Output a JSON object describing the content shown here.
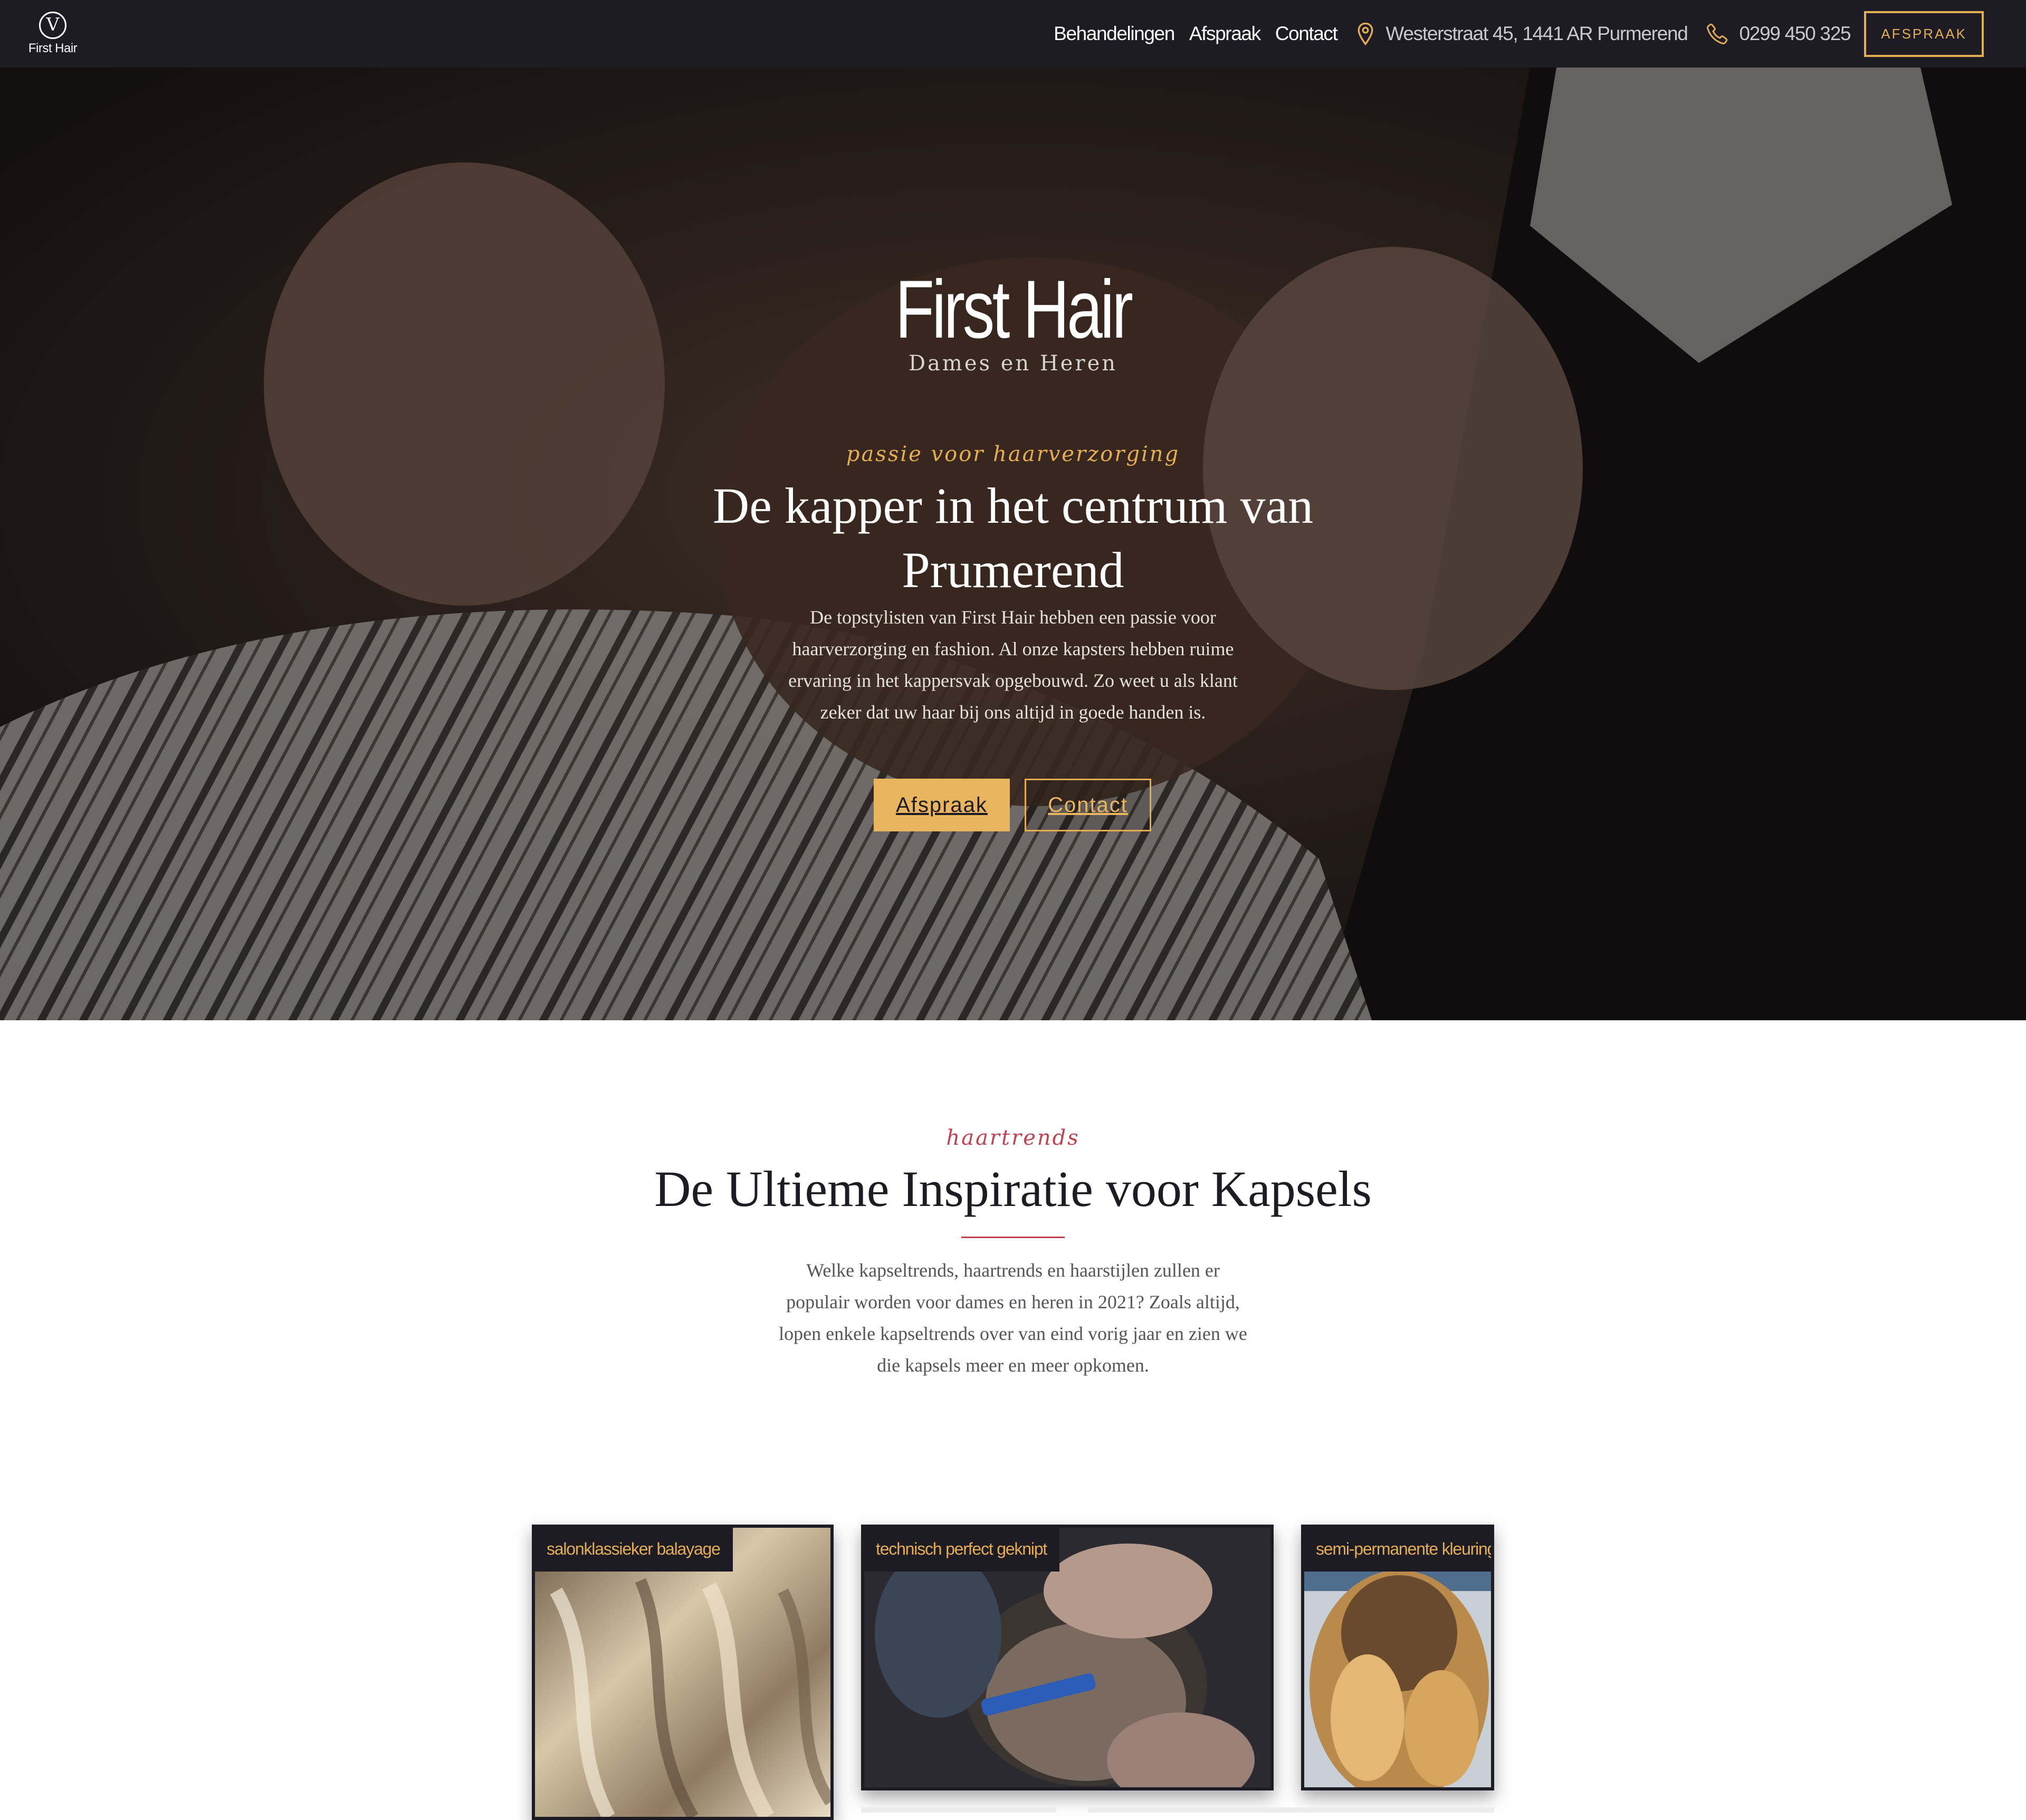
{
  "header": {
    "logo_mark": "V",
    "logo_text": "First Hair",
    "nav": [
      "Behandelingen",
      "Afspraak",
      "Contact"
    ],
    "address": "Westerstraat 45, 1441 AR Purmerend",
    "phone": "0299 450 325",
    "cta": "AFSPRAAK"
  },
  "hero": {
    "brand": "First Hair",
    "brand_sub": "Dames en Heren",
    "kicker": "passie voor haarverzorging",
    "heading": "De kapper in het centrum van Prumerend",
    "text": "De topstylisten van First Hair hebben een passie voor haarverzorging en fashion. Al onze kapsters hebben ruime ervaring in het kappersvak opgebouwd. Zo weet u als klant zeker dat uw haar bij ons altijd in goede handen is.",
    "btn_primary": "Afspraak",
    "btn_secondary": "Contact"
  },
  "inspiration": {
    "kicker": "haartrends",
    "title": "De Ultieme Inspiratie voor Kapsels",
    "text": "Welke kapseltrends, haartrends en haarstijlen zullen er populair worden voor dames en heren in 2021? Zoals altijd, lopen enkele kapseltrends over van eind vorig jaar en zien we die kapsels meer en meer opkomen."
  },
  "cards": [
    {
      "tag": "salonklassieker balayage"
    },
    {
      "tag": "technisch perfect geknipt"
    },
    {
      "tag": "semi-permanente kleuring"
    }
  ],
  "colors": {
    "header_bg": "#1d1c25",
    "accent_gold": "#e4ad52",
    "accent_red": "#c2434f",
    "text_dark": "#1d1c25"
  },
  "icons": [
    "location-pin-icon",
    "phone-icon"
  ]
}
